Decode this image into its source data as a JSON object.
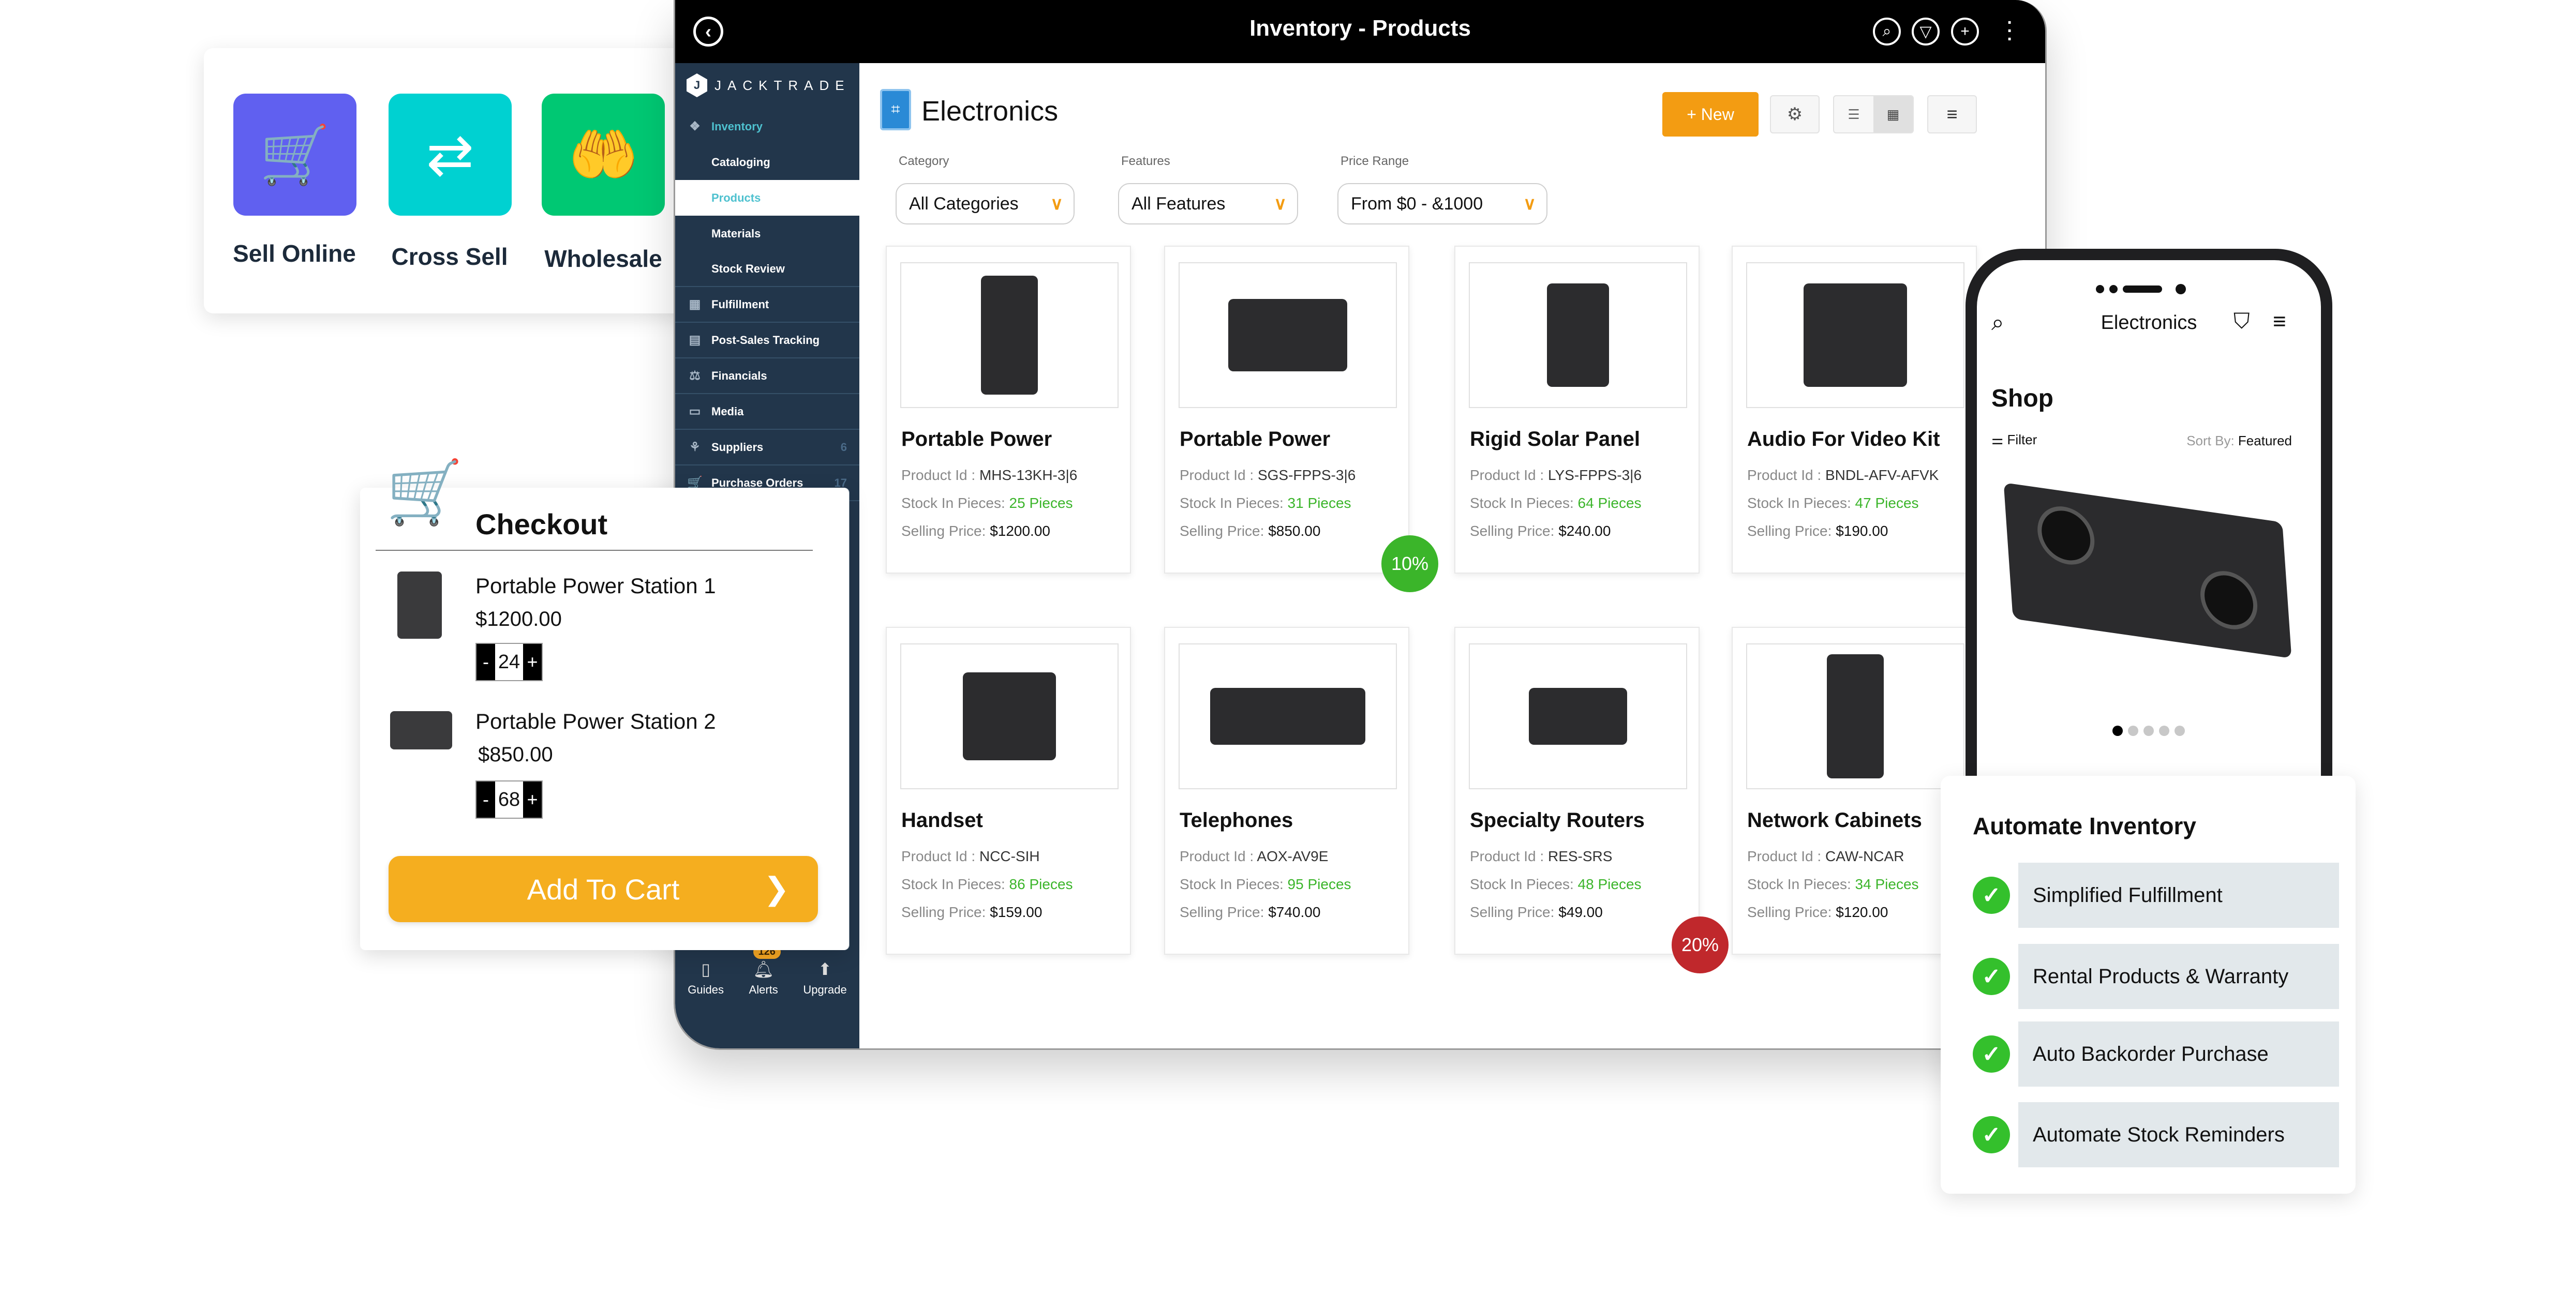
{
  "tablet": {
    "title": "Inventory - Products",
    "header_icons": [
      "back-icon",
      "search-icon",
      "filter-icon",
      "plus-icon",
      "more-icon"
    ],
    "brand": "JACKTRADE",
    "sidebar": {
      "inventory": {
        "label": "Inventory",
        "icon": "inventory-icon"
      },
      "sub_items": [
        {
          "label": "Cataloging",
          "active": false
        },
        {
          "label": "Products",
          "active": true
        },
        {
          "label": "Materials",
          "active": false
        },
        {
          "label": "Stock Review",
          "active": false
        }
      ],
      "items": [
        {
          "label": "Fulfillment",
          "icon": "fulfillment-icon",
          "count": ""
        },
        {
          "label": "Post-Sales Tracking",
          "icon": "tracking-icon",
          "count": ""
        },
        {
          "label": "Financials",
          "icon": "financials-icon",
          "count": ""
        },
        {
          "label": "Media",
          "icon": "media-icon",
          "count": ""
        },
        {
          "label": "Suppliers",
          "icon": "suppliers-icon",
          "count": "6"
        },
        {
          "label": "Purchase Orders",
          "icon": "purchase-orders-icon",
          "count": "17"
        }
      ],
      "footer": [
        {
          "label": "Guides",
          "icon": "book-icon"
        },
        {
          "label": "Alerts",
          "icon": "bell-icon",
          "badge": "126"
        },
        {
          "label": "Upgrade",
          "icon": "upgrade-arrow-icon"
        }
      ]
    },
    "category_title": "Electronics",
    "new_button": "+ New",
    "filters": [
      {
        "label": "Category",
        "value": "All Categories"
      },
      {
        "label": "Features",
        "value": "All Features"
      },
      {
        "label": "Price Range",
        "value": "From $0 - &1000"
      }
    ],
    "product_labels": {
      "id": "Product Id : ",
      "stock": "Stock In Pieces: ",
      "price": "Selling Price: "
    },
    "products": [
      {
        "name": "Portable Power",
        "id": "MHS-13KH-3|6",
        "stock": "25 Pieces",
        "price": "$1200.00",
        "discount": ""
      },
      {
        "name": "Portable Power",
        "id": "SGS-FPPS-3|6",
        "stock": "31 Pieces",
        "price": "$850.00",
        "discount": "10%"
      },
      {
        "name": "Rigid Solar Panel",
        "id": "LYS-FPPS-3|6",
        "stock": "64 Pieces",
        "price": "$240.00",
        "discount": ""
      },
      {
        "name": "Audio For Video Kit",
        "id": "BNDL-AFV-AFVK",
        "stock": "47 Pieces",
        "price": "$190.00",
        "discount": ""
      },
      {
        "name": "Handset",
        "id": "NCC-SIH",
        "stock": "86 Pieces",
        "price": "$159.00",
        "discount": ""
      },
      {
        "name": "Telephones",
        "id": "AOX-AV9E",
        "stock": "95 Pieces",
        "price": "$740.00",
        "discount": ""
      },
      {
        "name": "Specialty Routers",
        "id": "RES-SRS",
        "stock": "48 Pieces",
        "price": "$49.00",
        "discount": "20%"
      },
      {
        "name": "Network Cabinets",
        "id": "CAW-NCAR",
        "stock": "34 Pieces",
        "price": "$120.00",
        "discount": ""
      }
    ],
    "colors": {
      "accent": "#f39c12",
      "sidebar": "#22364b",
      "active": "#4ec1cf",
      "stock_green": "#3bb52a",
      "discount_green": "#3bb52a",
      "discount_red": "#c0282c"
    }
  },
  "sell_channels": [
    {
      "label": "Sell Online",
      "icon": "online-store-icon",
      "color": "#6060f0"
    },
    {
      "label": "Cross Sell",
      "icon": "cross-sell-icon",
      "color": "#00d1d1"
    },
    {
      "label": "Wholesale",
      "icon": "wholesale-icon",
      "color": "#00c873"
    }
  ],
  "checkout": {
    "title": "Checkout",
    "items": [
      {
        "name": "Portable Power Station 1",
        "price": "$1200.00",
        "qty": "24"
      },
      {
        "name": "Portable Power Station 2",
        "price": "$850.00",
        "qty": "68"
      }
    ],
    "minus": "-",
    "plus": "+",
    "add_to_cart": "Add To Cart"
  },
  "phone": {
    "title": "Electronics",
    "shop": "Shop",
    "filter": "Filter",
    "sort_label": "Sort By: ",
    "sort_value": "Featured",
    "carousel": {
      "count": 5,
      "active": 0
    }
  },
  "automate": {
    "title": "Automate Inventory",
    "items": [
      "Simplified Fulfillment",
      "Rental Products & Warranty",
      "Auto Backorder Purchase",
      "Automate Stock Reminders"
    ]
  }
}
